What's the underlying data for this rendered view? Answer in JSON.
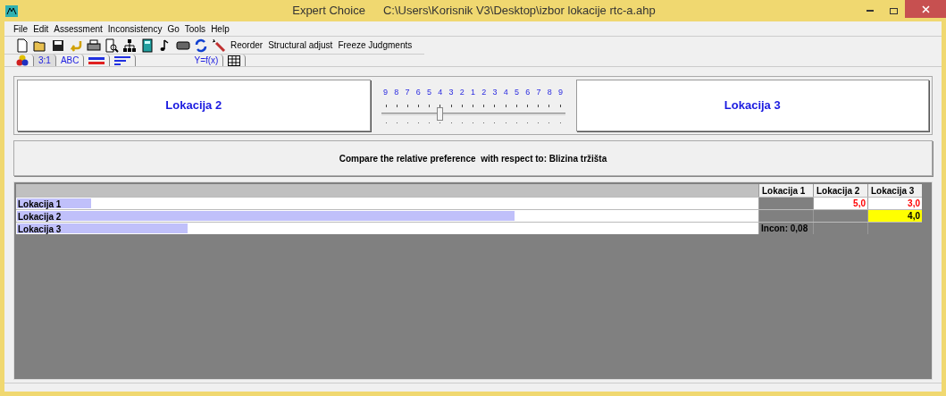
{
  "window": {
    "app_title": "Expert Choice",
    "file_path": "C:\\Users\\Korisnik V3\\Desktop\\izbor lokacije rtc-a.ahp"
  },
  "menu": [
    "File",
    "Edit",
    "Assessment",
    "Inconsistency",
    "Go",
    "Tools",
    "Help"
  ],
  "toolbar": {
    "icons": [
      {
        "kind": "new"
      },
      {
        "kind": "open"
      },
      {
        "kind": "save"
      },
      {
        "kind": "undo"
      },
      {
        "kind": "print"
      },
      {
        "kind": "preview"
      },
      {
        "kind": "hierarchy"
      },
      {
        "kind": "calculator"
      },
      {
        "kind": "note"
      },
      {
        "kind": "rect"
      },
      {
        "kind": "refresh"
      },
      {
        "kind": "wand"
      }
    ],
    "buttons": [
      "Reorder",
      "Structural adjust",
      "Freeze Judgments"
    ]
  },
  "tabs": [
    {
      "kind": "shapes",
      "selected": false
    },
    {
      "kind": "text",
      "label": "3:1",
      "selected": true
    },
    {
      "kind": "text",
      "label": "ABC",
      "selected": false
    },
    {
      "kind": "lines",
      "selected": false
    },
    {
      "kind": "bars",
      "selected": false
    },
    {
      "kind": "text",
      "label": "Y=f(x)",
      "selected": false
    },
    {
      "kind": "grid",
      "selected": false
    }
  ],
  "comparison": {
    "left": "Lokacija 2",
    "right": "Lokacija 3",
    "scale": [
      "9",
      "8",
      "7",
      "6",
      "5",
      "4",
      "3",
      "2",
      "1",
      "2",
      "3",
      "4",
      "5",
      "6",
      "7",
      "8",
      "9"
    ],
    "level": 0.31,
    "prompt": "Compare the relative preference  with respect to: Blizina tržišta"
  },
  "matrix": {
    "columns": [
      "Lokacija 1",
      "Lokacija 2",
      "Lokacija 3"
    ],
    "rows": [
      {
        "label": "Lokacija 1",
        "level": 0.1,
        "cells": [
          {
            "kind": "blank"
          },
          {
            "kind": "judgment",
            "text": "5,0",
            "inverse": true,
            "selected": false
          },
          {
            "kind": "judgment",
            "text": "3,0",
            "inverse": true,
            "selected": false
          }
        ]
      },
      {
        "label": "Lokacija 2",
        "level": 0.67,
        "cells": [
          {
            "kind": "blank"
          },
          {
            "kind": "blank"
          },
          {
            "kind": "judgment",
            "text": "4,0",
            "inverse": false,
            "selected": true
          }
        ]
      },
      {
        "label": "Lokacija 3",
        "level": 0.23,
        "cells": [
          {
            "kind": "note",
            "text": "Incon: 0,08"
          },
          {
            "kind": "blank"
          },
          {
            "kind": "blank"
          }
        ]
      }
    ]
  }
}
